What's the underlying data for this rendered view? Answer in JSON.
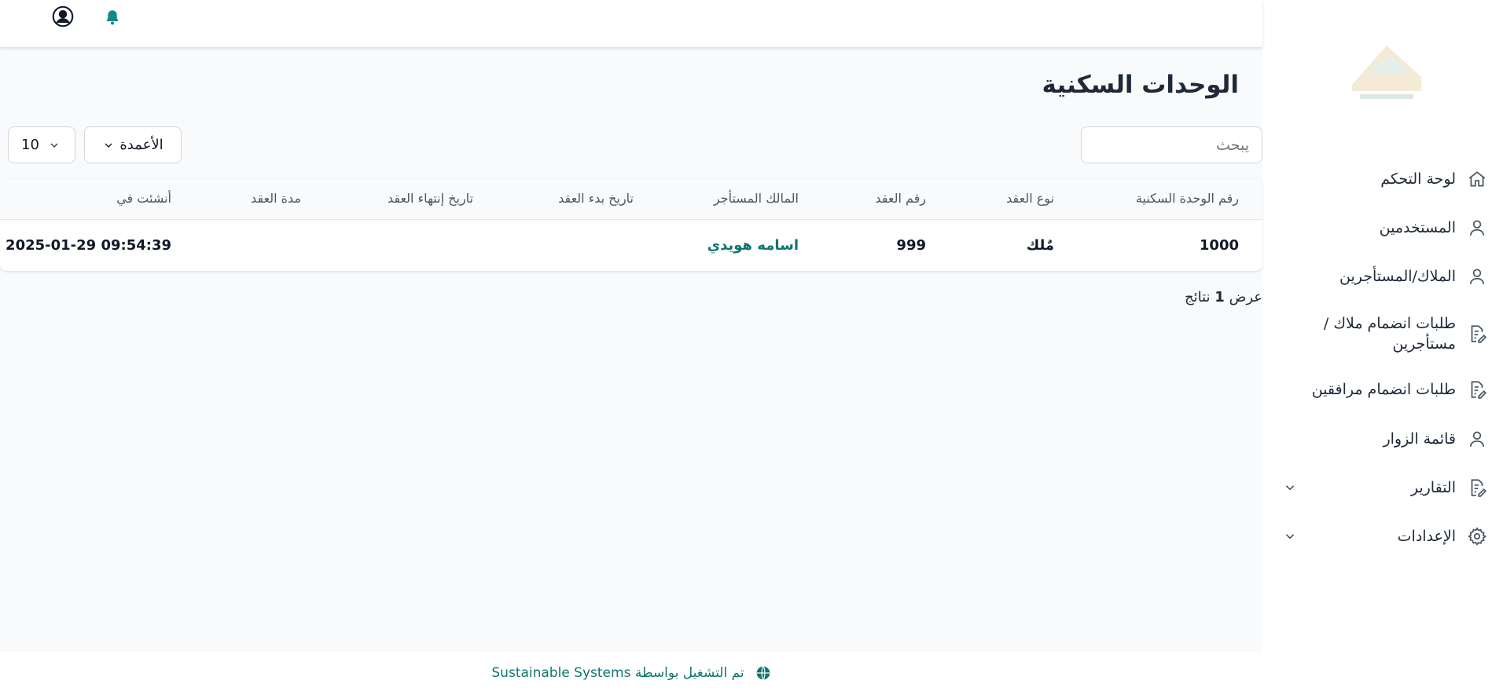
{
  "header": {
    "profile_icon": "user-circle-icon",
    "notification_icon": "bell-icon",
    "bell_color": "#0f8a86"
  },
  "sidebar": {
    "items": [
      {
        "label": "لوحة التحكم",
        "icon": "home-icon"
      },
      {
        "label": "المستخدمين",
        "icon": "user-icon"
      },
      {
        "label": "الملاك/المستأجرين",
        "icon": "user-icon"
      },
      {
        "label": "طلبات انضمام ملاك / مستأجرين",
        "icon": "edit-document-icon"
      },
      {
        "label": "طلبات انضمام مرافقين",
        "icon": "edit-document-icon"
      },
      {
        "label": "قائمة الزوار",
        "icon": "user-icon"
      },
      {
        "label": "التقارير",
        "icon": "edit-document-icon",
        "expandable": true
      },
      {
        "label": "الإعدادات",
        "icon": "gear-icon",
        "expandable": true
      }
    ]
  },
  "main": {
    "title": "الوحدات السكنية",
    "search_placeholder": "يبحث",
    "columns_label": "الأعمدة",
    "per_page": "10",
    "table": {
      "headers": [
        "رقم الوحدة السكنية",
        "نوع العقد",
        "رقم العقد",
        "المالك المستأجر",
        "تاريخ بدء العقد",
        "تاريخ إنتهاء العقد",
        "مدة العقد",
        "أنشئت في"
      ],
      "rows": [
        [
          "1000",
          "مٌلك",
          "999",
          "اسامه هويدي",
          "",
          "",
          "",
          "2025-01-29 09:54:39"
        ]
      ]
    },
    "results_prefix": "عرض",
    "results_count": "1",
    "results_suffix": "نتائج"
  },
  "footer": {
    "text": "تم التشغيل بواسطة Sustainable Systems",
    "icon": "globe-icon",
    "accent": "#0f766e"
  }
}
